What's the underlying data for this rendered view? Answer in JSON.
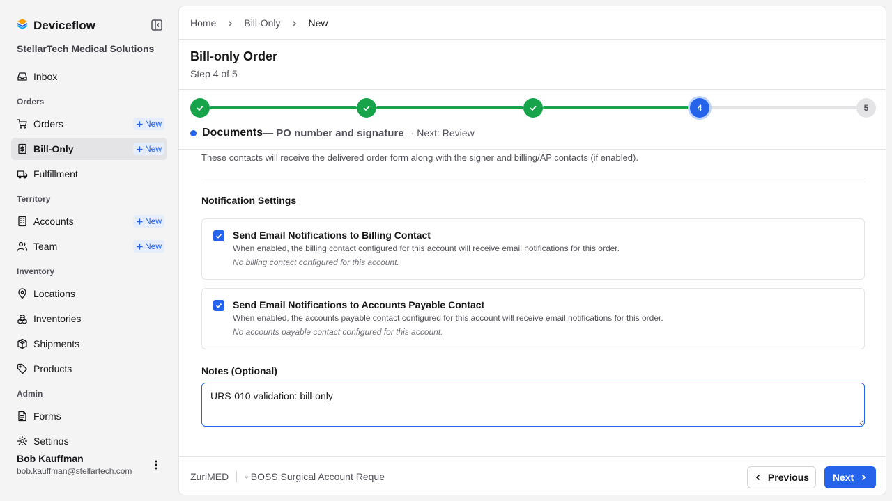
{
  "app": {
    "name": "Deviceflow",
    "org": "StellarTech Medical Solutions"
  },
  "sidebar": {
    "items": [
      {
        "type": "item",
        "label": "Inbox",
        "icon": "inbox-icon"
      },
      {
        "type": "section",
        "label": "Orders"
      },
      {
        "type": "item",
        "label": "Orders",
        "icon": "cart-icon",
        "badge": "New"
      },
      {
        "type": "item",
        "label": "Bill-Only",
        "icon": "receipt-icon",
        "badge": "New",
        "active": true
      },
      {
        "type": "item",
        "label": "Fulfillment",
        "icon": "truck-icon"
      },
      {
        "type": "section",
        "label": "Territory"
      },
      {
        "type": "item",
        "label": "Accounts",
        "icon": "building-icon",
        "badge": "New"
      },
      {
        "type": "item",
        "label": "Team",
        "icon": "users-icon",
        "badge": "New"
      },
      {
        "type": "section",
        "label": "Inventory"
      },
      {
        "type": "item",
        "label": "Locations",
        "icon": "map-pin-icon"
      },
      {
        "type": "item",
        "label": "Inventories",
        "icon": "boxes-icon"
      },
      {
        "type": "item",
        "label": "Shipments",
        "icon": "package-icon"
      },
      {
        "type": "item",
        "label": "Products",
        "icon": "tag-icon"
      },
      {
        "type": "section",
        "label": "Admin"
      },
      {
        "type": "item",
        "label": "Forms",
        "icon": "file-icon"
      },
      {
        "type": "item",
        "label": "Settings",
        "icon": "gear-icon"
      }
    ]
  },
  "user": {
    "name": "Bob Kauffman",
    "email": "bob.kauffman@stellartech.com"
  },
  "breadcrumb": {
    "home": "Home",
    "section": "Bill-Only",
    "current": "New"
  },
  "page": {
    "title": "Bill-only Order",
    "step_text": "Step 4 of 5"
  },
  "stepper": {
    "current_number": "4",
    "future_number": "5",
    "current_name": "Documents",
    "current_desc": "— PO number and signature",
    "next_text": "·  Next: Review"
  },
  "content": {
    "contacts_note": "These contacts will receive the delivered order form along with the signer and billing/AP contacts (if enabled).",
    "notification_title": "Notification Settings",
    "billing": {
      "title": "Send Email Notifications to Billing Contact",
      "desc": "When enabled, the billing contact configured for this account will receive email notifications for this order.",
      "empty": "No billing contact configured for this account.",
      "checked": true
    },
    "ap": {
      "title": "Send Email Notifications to Accounts Payable Contact",
      "desc": "When enabled, the accounts payable contact configured for this account will receive email notifications for this order.",
      "empty": "No accounts payable contact configured for this account.",
      "checked": true
    },
    "notes_label": "Notes (Optional)",
    "notes_value": "URS-010 validation: bill-only"
  },
  "footer": {
    "vendor": "ZuriMED",
    "account": "BOSS Surgical Account Reque",
    "prev_label": "Previous",
    "next_label": "Next"
  },
  "colors": {
    "accent": "#2563eb",
    "done": "#16a34a",
    "badge_bg": "#e5edfb"
  }
}
